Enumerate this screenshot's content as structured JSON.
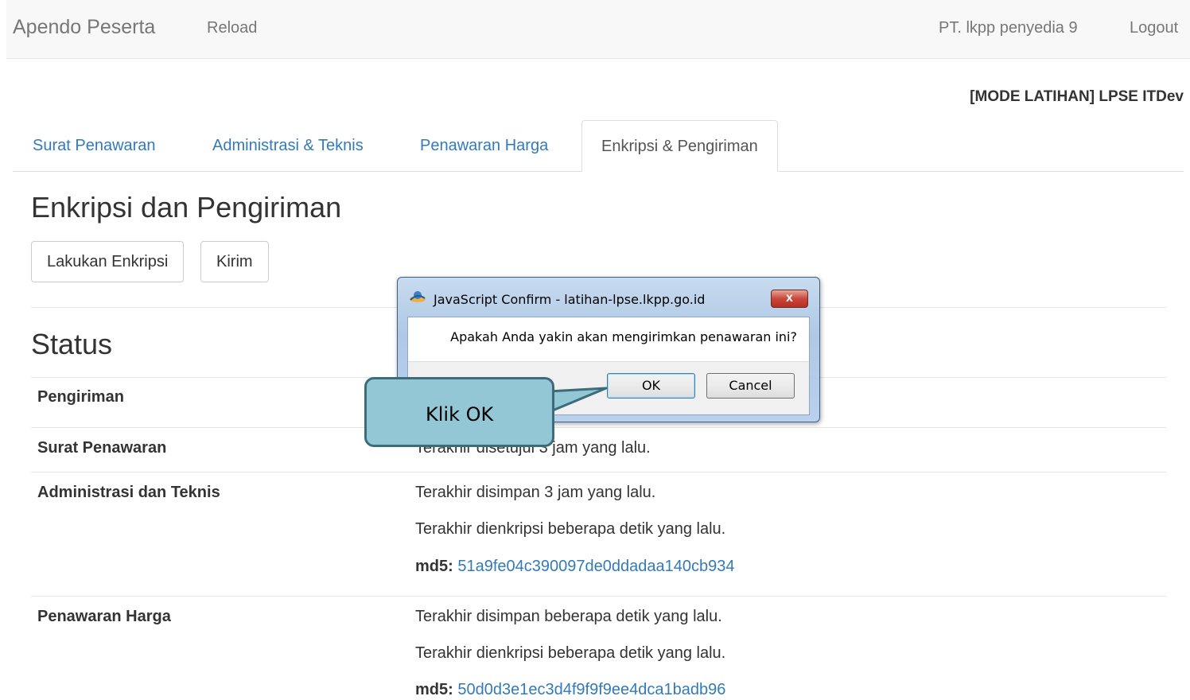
{
  "navbar": {
    "brand": "Apendo Peserta",
    "reload": "Reload",
    "user": "PT. lkpp penyedia 9",
    "logout": "Logout"
  },
  "mode_label": "[MODE LATIHAN] LPSE ITDev",
  "tabs": [
    {
      "label": "Surat Penawaran",
      "active": false
    },
    {
      "label": "Administrasi & Teknis",
      "active": false
    },
    {
      "label": "Penawaran Harga",
      "active": false
    },
    {
      "label": "Enkripsi & Pengiriman",
      "active": true
    }
  ],
  "section_title": "Enkripsi dan Pengiriman",
  "buttons": {
    "encrypt": "Lakukan Enkripsi",
    "send": "Kirim"
  },
  "status": {
    "title": "Status",
    "rows": [
      {
        "label": "Pengiriman",
        "lines": []
      },
      {
        "label": "Surat Penawaran",
        "lines": [
          "Terakhir disetujui 3 jam yang lalu."
        ]
      },
      {
        "label": "Administrasi dan Teknis",
        "lines": [
          "Terakhir disimpan 3 jam yang lalu.",
          "Terakhir dienkripsi beberapa detik yang lalu."
        ],
        "md5_key": "md5:",
        "md5": "51a9fe04c390097de0ddadaa140cb934"
      },
      {
        "label": "Penawaran Harga",
        "lines": [
          "Terakhir disimpan beberapa detik yang lalu.",
          "Terakhir dienkripsi beberapa detik yang lalu."
        ],
        "md5_key": "md5:",
        "md5": "50d0d3e1ec3d4f9f9f9ee4dca1badb96"
      }
    ]
  },
  "dialog": {
    "title": "JavaScript Confirm - latihan-lpse.lkpp.go.id",
    "message": "Apakah Anda yakin akan mengirimkan penawaran ini?",
    "ok": "OK",
    "cancel": "Cancel",
    "close": "x"
  },
  "callout": {
    "text": "Klik OK"
  },
  "colors": {
    "link": "#337ab7",
    "navbar_bg": "#f8f8f8",
    "callout_fill": "#93c7d6",
    "callout_border": "#3d6b7a",
    "close_button": "#c9473a"
  }
}
